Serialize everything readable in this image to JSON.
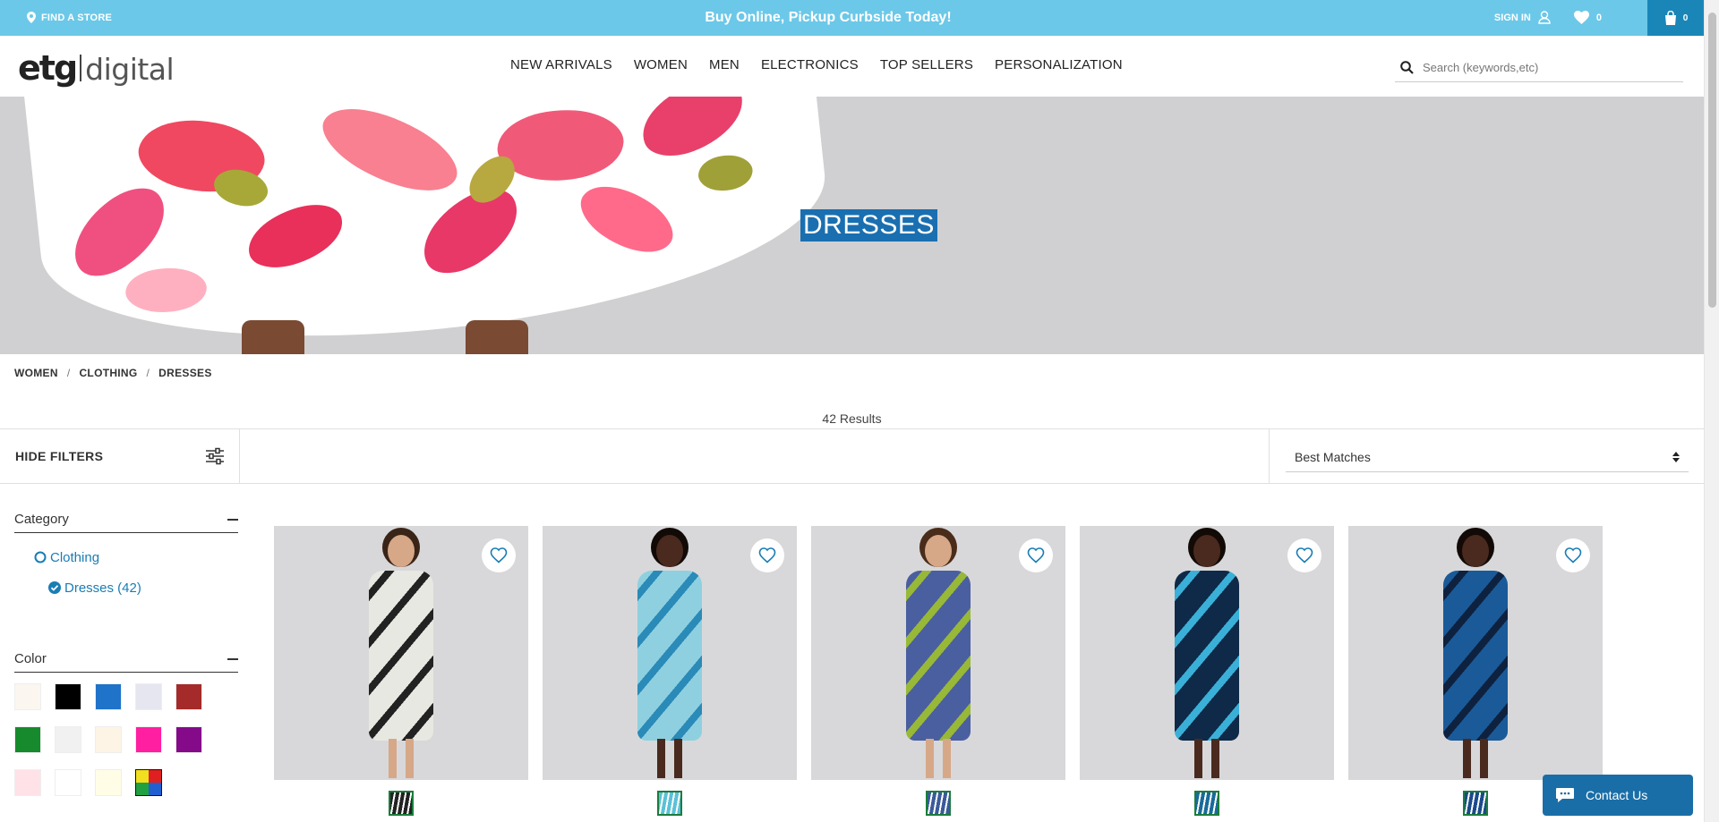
{
  "topbar": {
    "find_store": "FIND A STORE",
    "promo": "Buy Online, Pickup Curbside Today!",
    "sign_in": "SIGN IN",
    "wishlist_count": "0",
    "cart_count": "0"
  },
  "header": {
    "logo_part1": "etg",
    "logo_part2": "digital",
    "nav": [
      "NEW ARRIVALS",
      "WOMEN",
      "MEN",
      "ELECTRONICS",
      "TOP SELLERS",
      "PERSONALIZATION"
    ],
    "search_placeholder": "Search (keywords,etc)"
  },
  "hero": {
    "title": "DRESSES"
  },
  "breadcrumb": [
    "WOMEN",
    "CLOTHING",
    "DRESSES"
  ],
  "results": "42 Results",
  "filters": {
    "hide_label": "HIDE FILTERS",
    "sort_value": "Best Matches",
    "category": {
      "title": "Category",
      "items": [
        {
          "label": "Clothing",
          "selected": false
        },
        {
          "label": "Dresses (42)",
          "selected": true
        }
      ]
    },
    "color": {
      "title": "Color",
      "swatches": [
        "#fbf7f0",
        "#000000",
        "#1f73c9",
        "#e6e6f0",
        "#a52a2a",
        "#178a2e",
        "#f1f1f1",
        "#fdf4e6",
        "#ff1fa0",
        "#850a8a",
        "#ffe2e7",
        "#ffffff",
        "#fffde6",
        "multi"
      ]
    }
  },
  "products": [
    {
      "dress_color": "#e8e8e2",
      "pattern": "#222",
      "skin": "#d6a888",
      "hair": "#3a2418",
      "thumb": "#222"
    },
    {
      "dress_color": "#8fd0e0",
      "pattern": "#2a8ab8",
      "skin": "#4a2a1e",
      "hair": "#120a06",
      "thumb": "#5cc0d8"
    },
    {
      "dress_color": "#4a5fa0",
      "pattern": "#98b838",
      "skin": "#d6a888",
      "hair": "#4a2c1a",
      "thumb": "#3a5a9a"
    },
    {
      "dress_color": "#0e2a48",
      "pattern": "#3ab0d8",
      "skin": "#4a2a1e",
      "hair": "#120a06",
      "thumb": "#1a6a9a"
    },
    {
      "dress_color": "#1a5a98",
      "pattern": "#0e2240",
      "skin": "#4a2a1e",
      "hair": "#120a06",
      "thumb": "#1a4a8a"
    }
  ],
  "chat": {
    "label": "Contact Us"
  }
}
